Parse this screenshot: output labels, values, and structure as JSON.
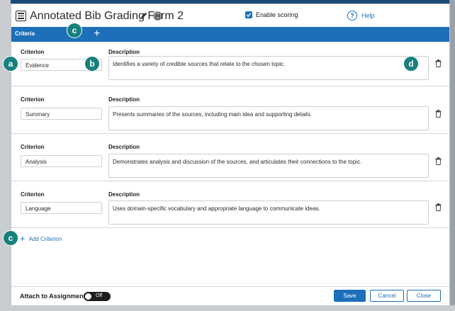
{
  "window": {
    "title": "Annotated Bib Grading Form 2",
    "enable_scoring_label": "Enable scoring",
    "enable_scoring_checked": true,
    "help_label": "Help",
    "help_glyph": "?"
  },
  "tabs": {
    "criteria_label": "Criteria",
    "add_glyph": "+"
  },
  "columns": {
    "criterion_header": "Criterion",
    "description_header": "Description"
  },
  "criteria": [
    {
      "name": "Evidence",
      "description": "Identifies a variety of credible sources that relate to the chosen topic."
    },
    {
      "name": "Summary",
      "description": "Presents summaries of the sources, including main idea and supporting details."
    },
    {
      "name": "Analysis",
      "description": "Demonstrates analysis and discussion of the sources, and articulates their connections to the topic."
    },
    {
      "name": "Language",
      "description": "Uses domain-specific vocabulary and appropriate language to communicate ideas."
    }
  ],
  "add_criterion": {
    "glyph": "+",
    "label": "Add Criterion"
  },
  "footer": {
    "attach_label": "Attach to Assignment",
    "toggle_state": "Off",
    "save_label": "Save",
    "cancel_label": "Cancel",
    "close_label": "Close"
  },
  "callouts": {
    "a": "a",
    "b": "b",
    "c1": "c",
    "c2": "c",
    "d": "d"
  },
  "colors": {
    "accent": "#1c6fb8",
    "callout": "#17807c"
  },
  "icons": [
    "menu-icon",
    "pencil-icon",
    "gear-icon",
    "checkbox-icon",
    "help-icon",
    "plus-icon",
    "trash-icon"
  ]
}
